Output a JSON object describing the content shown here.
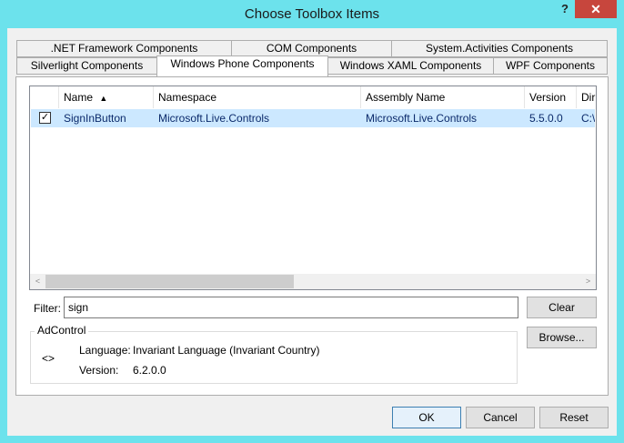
{
  "window": {
    "title": "Choose Toolbox Items",
    "help": "?",
    "close": "✕"
  },
  "tabs": {
    "row1": [
      ".NET Framework Components",
      "COM Components",
      "System.Activities Components"
    ],
    "row2": [
      "Silverlight Components",
      "Windows Phone Components",
      "Windows XAML Components",
      "WPF Components"
    ],
    "active": "Windows Phone Components"
  },
  "list": {
    "columns": [
      "Name",
      "Namespace",
      "Assembly Name",
      "Version",
      "Dir"
    ],
    "sort_indicator": "▲",
    "rows": [
      {
        "checked": true,
        "check_glyph": "✓",
        "name": "SignInButton",
        "namespace": "Microsoft.Live.Controls",
        "assembly": "Microsoft.Live.Controls",
        "version": "5.5.0.0",
        "dir": "C:\\"
      }
    ],
    "scroll_left": "<",
    "scroll_right": ">"
  },
  "filter": {
    "label": "Filter:",
    "value": "sign",
    "clear": "Clear"
  },
  "details": {
    "title": "AdControl",
    "icon": "<>",
    "language_label": "Language:",
    "language_value": "Invariant Language (Invariant Country)",
    "version_label": "Version:",
    "version_value": "6.2.0.0",
    "browse": "Browse..."
  },
  "buttons": {
    "ok": "OK",
    "cancel": "Cancel",
    "reset": "Reset"
  },
  "colors": {
    "frame": "#6ce2ec",
    "close": "#c7463d",
    "selection": "#cce8ff"
  }
}
